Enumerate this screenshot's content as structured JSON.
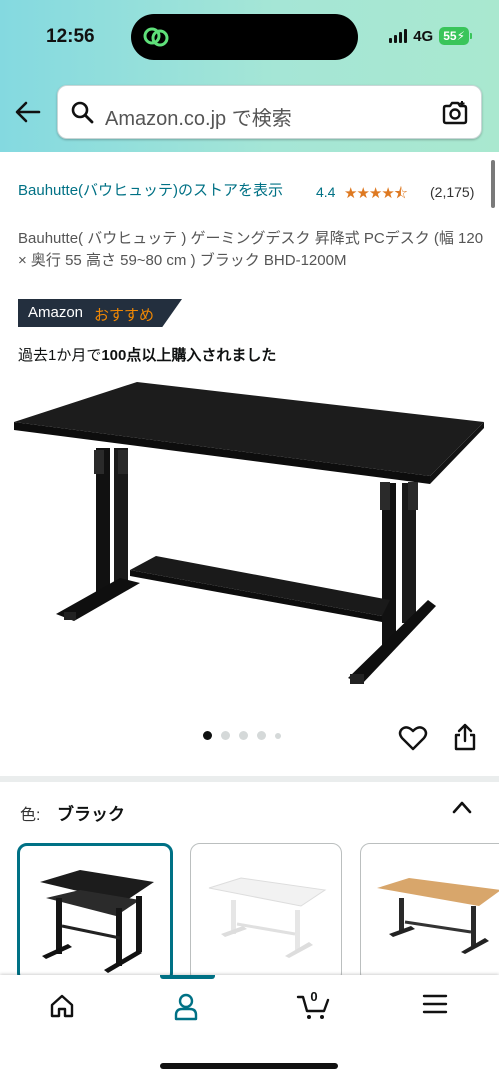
{
  "status_bar": {
    "time": "12:56",
    "network": "4G",
    "battery": "55"
  },
  "search": {
    "placeholder": "Amazon.co.jp で検索"
  },
  "product": {
    "store_link": "Bauhutte(バウヒュッテ)のストアを表示",
    "rating": "4.4",
    "stars": "★★★★⯪",
    "rating_count": "(2,175)",
    "title": "Bauhutte( バウヒュッテ ) ゲーミングデスク 昇降式 PCデスク (幅 120 × 奥行 55 高さ 59~80 cm ) ブラック BHD-1200M",
    "badge_brand": "Amazon",
    "badge_label": "おすすめ",
    "purchases_prefix": "過去1か月で",
    "purchases_bold": "100点以上購入されました",
    "image_count": 5,
    "active_image": 1
  },
  "variation": {
    "label": "色:",
    "value": "ブラック",
    "options": [
      "black",
      "white",
      "wood"
    ]
  },
  "bottom_nav": {
    "items": [
      "home",
      "account",
      "cart",
      "menu"
    ],
    "cart_count": "0",
    "active": "account"
  },
  "colors": {
    "accent": "#007185",
    "star": "#de7921",
    "badge_bg": "#232f3e",
    "badge_orange": "#f08804"
  }
}
